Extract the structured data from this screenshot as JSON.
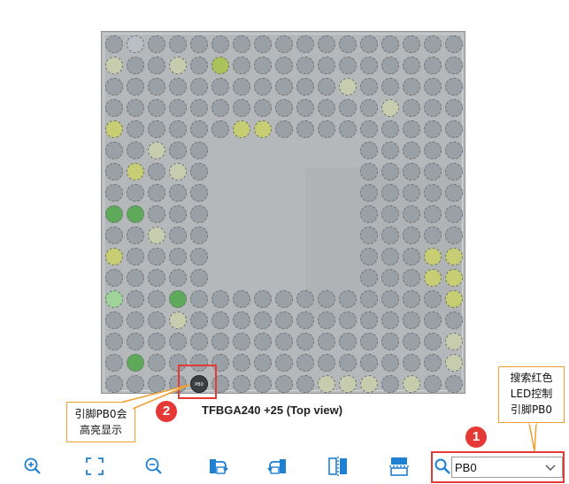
{
  "package": {
    "label": "TFBGA240 +25 (Top view)"
  },
  "highlight": {
    "pin_text": "PB0"
  },
  "search": {
    "value": "PB0"
  },
  "callouts": [
    {
      "id": "search",
      "text": "搜索红色\nLED控制\n引脚PB0",
      "step": "1"
    },
    {
      "id": "highlight",
      "text": "引脚PB0会\n高亮显示",
      "step": "2"
    }
  ],
  "toolbar": {
    "buttons": [
      {
        "name": "zoom-in-button",
        "icon": "zoom-in-icon"
      },
      {
        "name": "fit-to-window-button",
        "icon": "fit-to-window-icon"
      },
      {
        "name": "zoom-out-button",
        "icon": "zoom-out-icon"
      },
      {
        "name": "rotate-right-button",
        "icon": "rotate-right-icon"
      },
      {
        "name": "rotate-left-button",
        "icon": "rotate-left-icon"
      },
      {
        "name": "flip-vertical-button",
        "icon": "flip-vertical-icon"
      },
      {
        "name": "flip-horizontal-button",
        "icon": "flip-horizontal-icon"
      }
    ]
  },
  "colors": {
    "accent": "#e53935",
    "callout_border": "#f0a030",
    "icon_blue": "#1f7fd1"
  }
}
